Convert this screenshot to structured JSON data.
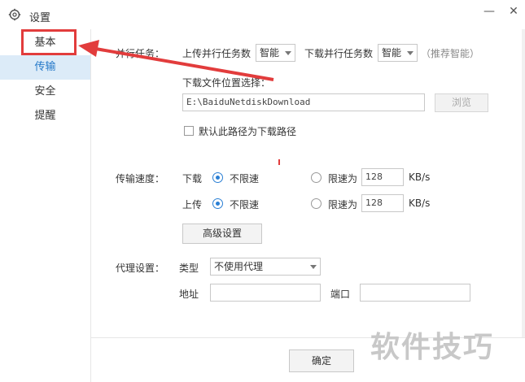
{
  "window": {
    "title": "设置",
    "minimize": "—",
    "close": "✕",
    "icon": "gear-icon"
  },
  "sidebar": {
    "items": [
      {
        "label": "基本",
        "active": false
      },
      {
        "label": "传输",
        "active": true
      },
      {
        "label": "安全",
        "active": false
      },
      {
        "label": "提醒",
        "active": false
      }
    ]
  },
  "parallel": {
    "label": "并行任务：",
    "upload_label": "上传并行任务数",
    "upload_value": "智能",
    "download_label": "下载并行任务数",
    "download_value": "智能",
    "recommend": "（推荐智能）"
  },
  "download_path": {
    "label": "下载文件位置选择：",
    "value": "E:\\BaiduNetdiskDownload",
    "browse_label": "浏览",
    "default_checkbox_label": "默认此路径为下载路径",
    "default_checked": false
  },
  "speed": {
    "label": "传输速度：",
    "download": {
      "label": "下载",
      "unlimited": "不限速",
      "limit": "限速为",
      "value": "128",
      "unit": "KB/s"
    },
    "upload": {
      "label": "上传",
      "unlimited": "不限速",
      "limit": "限速为",
      "value": "128",
      "unit": "KB/s"
    },
    "advanced_button": "高级设置"
  },
  "proxy": {
    "label": "代理设置：",
    "type_label": "类型",
    "type_value": "不使用代理",
    "address_label": "地址",
    "address_value": "",
    "port_label": "端口",
    "port_value": ""
  },
  "footer": {
    "confirm": "确定"
  },
  "watermark": "软件技巧",
  "colors": {
    "accent": "#2a7fd4",
    "highlight": "#e23c3c",
    "active_bg": "#dcebf8"
  }
}
